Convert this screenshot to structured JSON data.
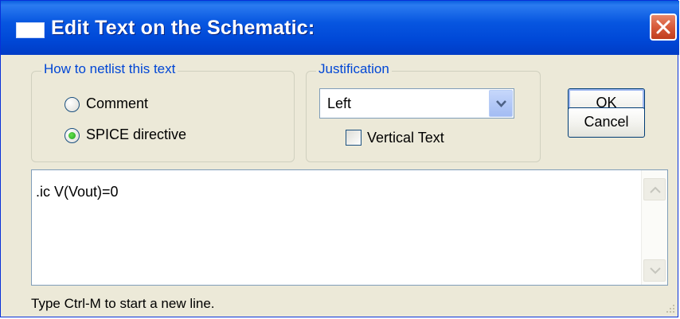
{
  "window": {
    "title": "Edit Text on the Schematic:",
    "icons": {
      "app": "window-icon",
      "close": "close-icon"
    }
  },
  "netlist_group": {
    "legend": "How to netlist this text",
    "options": [
      {
        "label": "Comment",
        "selected": false
      },
      {
        "label": "SPICE directive",
        "selected": true
      }
    ]
  },
  "justification_group": {
    "legend": "Justification",
    "selected": "Left",
    "vertical_text_label": "Vertical Text",
    "vertical_text_checked": false
  },
  "buttons": {
    "ok": "OK",
    "cancel": "Cancel"
  },
  "editor": {
    "text": ".ic V(Vout)=0"
  },
  "status": {
    "hint": "Type Ctrl-M to start a new line."
  },
  "colors": {
    "titlebar": "#0054e3",
    "close": "#d75b3a",
    "legend": "#0046d5",
    "radio_selected": "#21a121"
  }
}
